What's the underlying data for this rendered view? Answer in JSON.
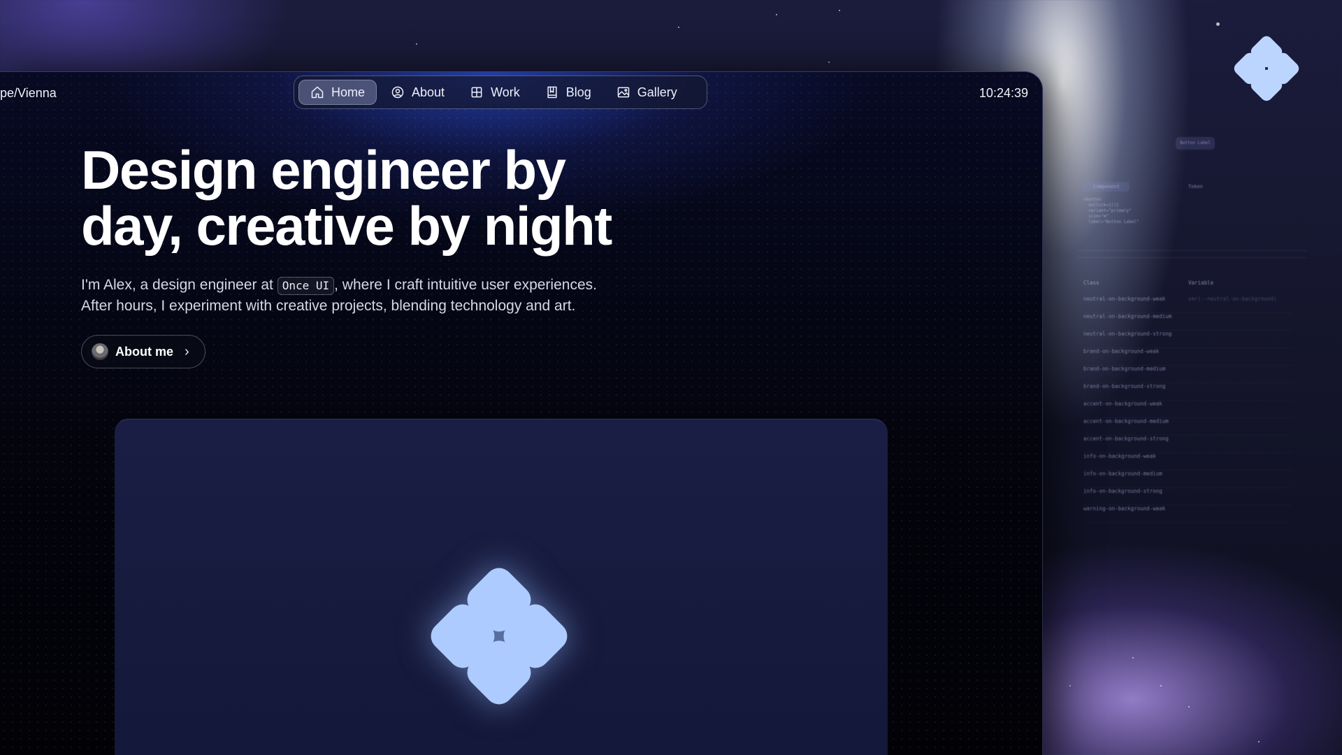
{
  "window": {
    "timezone_label": "pe/Vienna",
    "clock": "10:24:39"
  },
  "nav": {
    "items": [
      {
        "label": "Home",
        "icon": "home-icon",
        "active": true
      },
      {
        "label": "About",
        "icon": "user-circle-icon",
        "active": false
      },
      {
        "label": "Work",
        "icon": "grid-icon",
        "active": false
      },
      {
        "label": "Blog",
        "icon": "book-icon",
        "active": false
      },
      {
        "label": "Gallery",
        "icon": "image-icon",
        "active": false
      }
    ]
  },
  "hero": {
    "title_line1": "Design engineer by",
    "title_line2": "day, creative by night",
    "intro_before": "I'm Alex, a design engineer at ",
    "intro_code": "Once UI",
    "intro_after": ", where I craft intuitive user experiences.",
    "intro_line2": "After hours, I experiment with creative projects, blending technology and art.",
    "about_button": "About me"
  },
  "side_screen": {
    "pill": "Button Label",
    "tabs": [
      "Component",
      "Token"
    ],
    "code": "<Button\n  onClick={()}\n  variant=\"primary\"\n  size=\"m\"\n  label=\"Button Label\"",
    "columns": [
      "Class",
      "Variable"
    ],
    "rows": [
      "neutral-on-background-weak",
      "neutral-on-background-medium",
      "neutral-on-background-strong",
      "brand-on-background-weak",
      "brand-on-background-medium",
      "brand-on-background-strong",
      "accent-on-background-weak",
      "accent-on-background-medium",
      "accent-on-background-strong",
      "info-on-background-weak",
      "info-on-background-medium",
      "info-on-background-strong",
      "warning-on-background-weak"
    ]
  },
  "colors": {
    "accent": "#aecbff",
    "background": "#03040c",
    "card": "#161a3c"
  }
}
